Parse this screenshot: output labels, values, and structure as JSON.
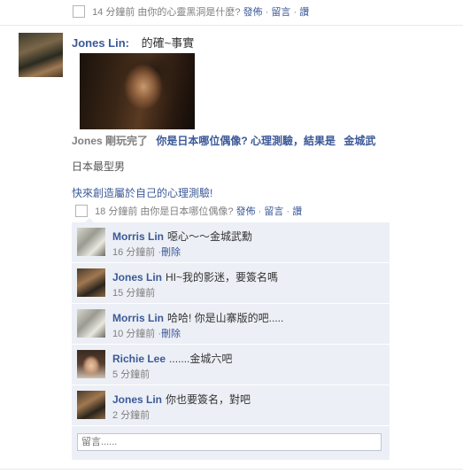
{
  "previous_story": {
    "time": "14 分鐘前",
    "via_text": "由你的心靈黑洞是什麼?",
    "publish": "發佈",
    "comment": "留言",
    "like": "讚"
  },
  "story": {
    "author": "Jones Lin:",
    "message": "的確~事實",
    "attachment": {
      "actor": "Jones 剛玩完了",
      "quiz_title": "你是日本哪位偶像? 心理測驗，結果是",
      "result": "金城武",
      "description": "日本最型男",
      "cta": "快來創造屬於自己的心理測驗!"
    },
    "meta": {
      "time": "18 分鐘前",
      "via_text": "由你是日本哪位偶像?",
      "publish": "發佈",
      "comment": "留言",
      "like": "讚"
    }
  },
  "comments": [
    {
      "author": "Morris Lin",
      "text": "噁心～～金城武勳",
      "time": "16 分鐘前",
      "action": "刪除",
      "avatar": "morris"
    },
    {
      "author": "Jones Lin",
      "text": "HI~我的影迷，要簽名嗎",
      "time": "15 分鐘前",
      "action": "",
      "avatar": "jones"
    },
    {
      "author": "Morris Lin",
      "text": "哈哈! 你是山寨版的吧.....",
      "time": "10 分鐘前",
      "action": "刪除",
      "avatar": "morris"
    },
    {
      "author": "Richie Lee",
      "text": ".......金城六吧",
      "time": "5 分鐘前",
      "action": "",
      "avatar": "richie"
    },
    {
      "author": "Jones Lin",
      "text": "你也要簽名，對吧",
      "time": "2 分鐘前",
      "action": "",
      "avatar": "jones"
    }
  ],
  "reply_placeholder": "留言......",
  "colors": {
    "link": "#3b5998",
    "comment_bg": "#eceff5",
    "meta": "#808080"
  }
}
